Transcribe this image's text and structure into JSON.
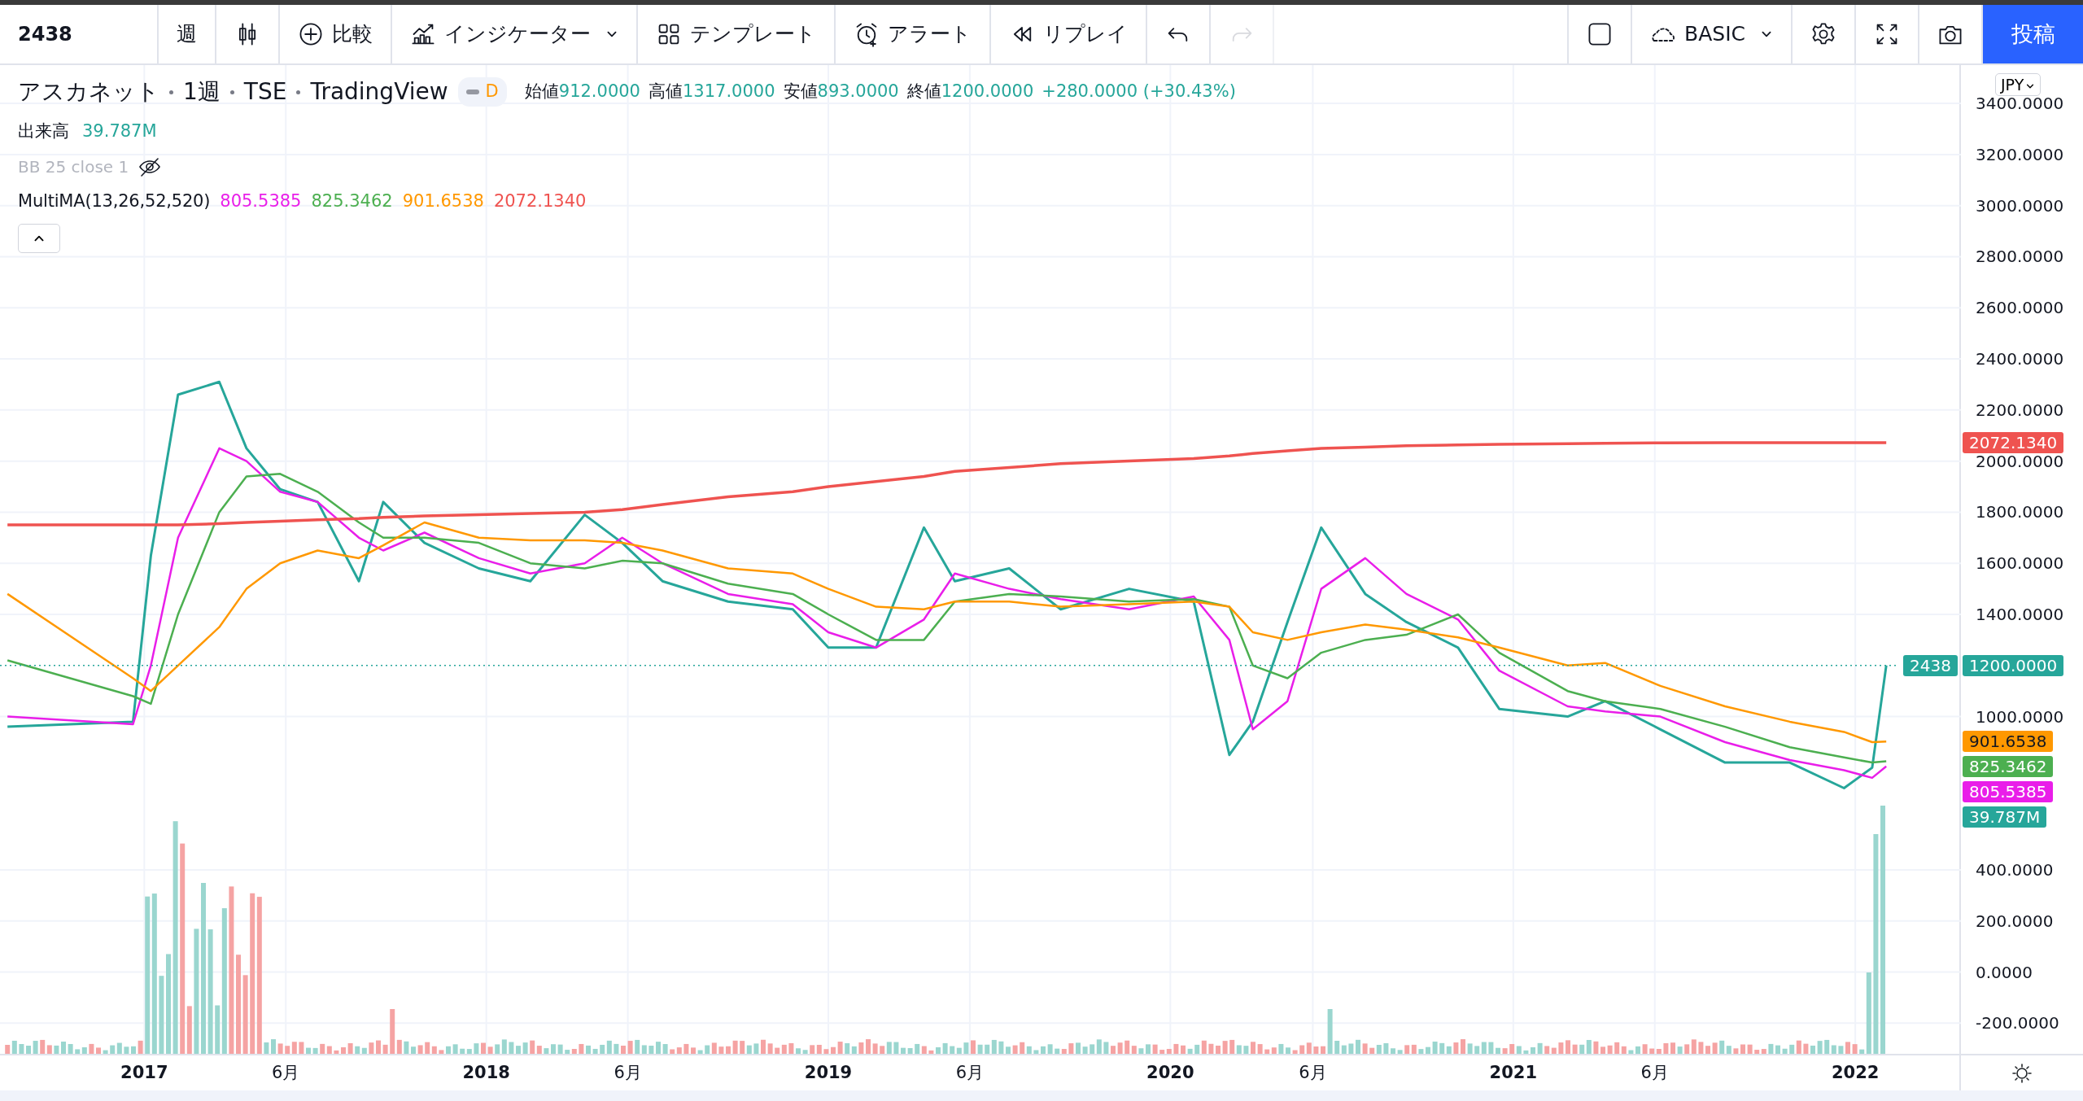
{
  "toolbar": {
    "symbol": "2438",
    "items": [
      {
        "kind": "interval",
        "label": "週",
        "disabled": false
      },
      {
        "kind": "chart_style",
        "disabled": false
      },
      {
        "kind": "compare",
        "label": "比較",
        "disabled": false
      },
      {
        "kind": "indicators",
        "label": "インジケーター",
        "disabled": false
      },
      {
        "kind": "templates",
        "label": "テンプレート",
        "disabled": false
      },
      {
        "kind": "alert",
        "label": "アラート",
        "disabled": false
      },
      {
        "kind": "replay",
        "label": "リプレイ",
        "disabled": false
      },
      {
        "kind": "undo",
        "disabled": false
      },
      {
        "kind": "redo",
        "disabled": true
      }
    ],
    "right_items": [
      {
        "kind": "layout"
      },
      {
        "kind": "cloud",
        "label": "BASIC"
      },
      {
        "kind": "settings"
      },
      {
        "kind": "fullscreen"
      },
      {
        "kind": "snapshot"
      },
      {
        "kind": "publish",
        "label": "投稿"
      }
    ]
  },
  "legend": {
    "title_parts": [
      "アスカネット",
      "1週",
      "TSE",
      "TradingView"
    ],
    "status_badge": "D",
    "ohlc": [
      {
        "label": "始値",
        "value": "912.0000"
      },
      {
        "label": "高値",
        "value": "1317.0000"
      },
      {
        "label": "安値",
        "value": "893.0000"
      },
      {
        "label": "終値",
        "value": "1200.0000"
      }
    ],
    "change": "+280.0000 (+30.43%)",
    "indicators": [
      {
        "kind": "volume",
        "name": "出来高",
        "hidden": false,
        "values": [
          {
            "text": "39.787M",
            "color": "#26a69a"
          }
        ]
      },
      {
        "kind": "bb",
        "name": "BB 25 close 1",
        "hidden": true
      },
      {
        "kind": "multi_ma",
        "name": "MultiMA(13,26,52,520)",
        "hidden": false,
        "values": [
          {
            "text": "805.5385",
            "color": "#e91ee9"
          },
          {
            "text": "825.3462",
            "color": "#4caf50"
          },
          {
            "text": "901.6538",
            "color": "#ff9800"
          },
          {
            "text": "2072.1340",
            "color": "#ef5350"
          }
        ]
      }
    ]
  },
  "currency": "JPY",
  "chart": {
    "chart_data": {
      "type": "line",
      "x": [
        "2016-08-08",
        "2016-12-20",
        "2017-01-08",
        "2017-02-06",
        "2017-03-22",
        "2017-04-20",
        "2017-05-26",
        "2017-07-05",
        "2017-08-18",
        "2017-09-13",
        "2017-10-27",
        "2017-12-24",
        "2018-02-17",
        "2018-04-16",
        "2018-05-26",
        "2018-07-08",
        "2018-09-16",
        "2018-11-24",
        "2019-01-01",
        "2019-02-21",
        "2019-04-13",
        "2019-05-16",
        "2019-07-13",
        "2019-09-06",
        "2019-11-18",
        "2020-01-26",
        "2020-03-04",
        "2020-03-29",
        "2020-05-05",
        "2020-06-10",
        "2020-07-27",
        "2020-09-09",
        "2020-11-03",
        "2020-12-17",
        "2021-02-28",
        "2021-04-09",
        "2021-06-07",
        "2021-08-15",
        "2021-10-23",
        "2021-12-20",
        "2022-01-19",
        "2022-02-03"
      ],
      "series": [
        {
          "color": "#26a69a",
          "values": [
            960,
            980,
            1630,
            2260,
            2310,
            2050,
            1890,
            1840,
            1530,
            1840,
            1680,
            1580,
            1530,
            1790,
            1680,
            1530,
            1450,
            1420,
            1270,
            1270,
            1740,
            1530,
            1580,
            1420,
            1500,
            1450,
            850,
            980,
            1370,
            1740,
            1480,
            1370,
            1270,
            1030,
            1000,
            1060,
            950,
            820,
            820,
            720,
            800,
            1200
          ]
        },
        {
          "color": "#e91ee9",
          "values": [
            1000,
            970,
            1200,
            1700,
            2050,
            2000,
            1880,
            1840,
            1700,
            1650,
            1720,
            1620,
            1560,
            1600,
            1700,
            1600,
            1480,
            1440,
            1330,
            1270,
            1380,
            1560,
            1500,
            1460,
            1420,
            1470,
            1300,
            950,
            1060,
            1500,
            1620,
            1480,
            1380,
            1180,
            1040,
            1020,
            1000,
            900,
            830,
            790,
            760,
            805
          ]
        },
        {
          "color": "#4caf50",
          "values": [
            1220,
            1080,
            1050,
            1400,
            1800,
            1940,
            1950,
            1880,
            1760,
            1700,
            1700,
            1680,
            1600,
            1580,
            1610,
            1600,
            1520,
            1480,
            1400,
            1300,
            1300,
            1450,
            1480,
            1470,
            1450,
            1460,
            1430,
            1200,
            1150,
            1250,
            1300,
            1320,
            1400,
            1250,
            1100,
            1060,
            1030,
            960,
            880,
            840,
            820,
            825
          ]
        },
        {
          "color": "#ff9800",
          "values": [
            1480,
            1150,
            1100,
            1200,
            1350,
            1500,
            1600,
            1650,
            1620,
            1670,
            1760,
            1700,
            1690,
            1690,
            1680,
            1650,
            1580,
            1560,
            1500,
            1430,
            1420,
            1450,
            1450,
            1430,
            1440,
            1450,
            1430,
            1330,
            1300,
            1330,
            1360,
            1340,
            1310,
            1270,
            1200,
            1210,
            1120,
            1040,
            980,
            940,
            900,
            902
          ]
        },
        {
          "color": "#ef5350",
          "values": [
            1750,
            1750,
            1750,
            1750,
            1755,
            1760,
            1765,
            1770,
            1775,
            1780,
            1785,
            1790,
            1795,
            1800,
            1810,
            1830,
            1860,
            1880,
            1900,
            1920,
            1940,
            1960,
            1975,
            1990,
            2000,
            2010,
            2020,
            2030,
            2040,
            2050,
            2055,
            2060,
            2063,
            2066,
            2068,
            2070,
            2071,
            2072,
            2072,
            2072,
            2072,
            2072
          ]
        }
      ],
      "xlim": [
        "2016-07-31",
        "2022-09-01"
      ],
      "ylim": [
        -320,
        3550
      ],
      "grid": true,
      "xticks": [
        {
          "value": "2017-01-01",
          "label": "2017"
        },
        {
          "value": "2017-06-01",
          "label": "6月"
        },
        {
          "value": "2018-01-01",
          "label": "2018"
        },
        {
          "value": "2018-06-01",
          "label": "6月"
        },
        {
          "value": "2019-01-01",
          "label": "2019"
        },
        {
          "value": "2019-06-01",
          "label": "6月"
        },
        {
          "value": "2020-01-01",
          "label": "2020"
        },
        {
          "value": "2020-06-01",
          "label": "6月"
        },
        {
          "value": "2021-01-01",
          "label": "2021"
        },
        {
          "value": "2021-06-01",
          "label": "6月"
        },
        {
          "value": "2022-01-01",
          "label": "2022"
        }
      ],
      "yticks": [
        {
          "value": 3400,
          "label": "3400.0000"
        },
        {
          "value": 3200,
          "label": "3200.0000"
        },
        {
          "value": 3000,
          "label": "3000.0000"
        },
        {
          "value": 2800,
          "label": "2800.0000"
        },
        {
          "value": 2600,
          "label": "2600.0000"
        },
        {
          "value": 2400,
          "label": "2400.0000"
        },
        {
          "value": 2200,
          "label": "2200.0000"
        },
        {
          "value": 2000,
          "label": "2000.0000"
        },
        {
          "value": 1800,
          "label": "1800.0000"
        },
        {
          "value": 1600,
          "label": "1600.0000"
        },
        {
          "value": 1400,
          "label": "1400.0000"
        },
        {
          "value": 1000,
          "label": "1000.0000"
        },
        {
          "value": 400,
          "label": "400.0000"
        },
        {
          "value": 200,
          "label": "200.0000"
        },
        {
          "value": 0,
          "label": "0.0000"
        },
        {
          "value": -200,
          "label": "-200.0000"
        }
      ]
    }
  },
  "price_labels": [
    {
      "kind": "ma",
      "text": "2072.1340",
      "color": "#ef5350"
    },
    {
      "kind": "last",
      "text": "1200.0000",
      "color": "#26a69a",
      "symbol_tag": "2438"
    },
    {
      "kind": "ma",
      "text": "901.6538",
      "color": "#ff9800"
    },
    {
      "kind": "ma",
      "text": "825.3462",
      "color": "#4caf50"
    },
    {
      "kind": "ma",
      "text": "805.5385",
      "color": "#e91ee9"
    },
    {
      "kind": "volume",
      "text": "39.787M",
      "color": "#26a69a"
    }
  ]
}
